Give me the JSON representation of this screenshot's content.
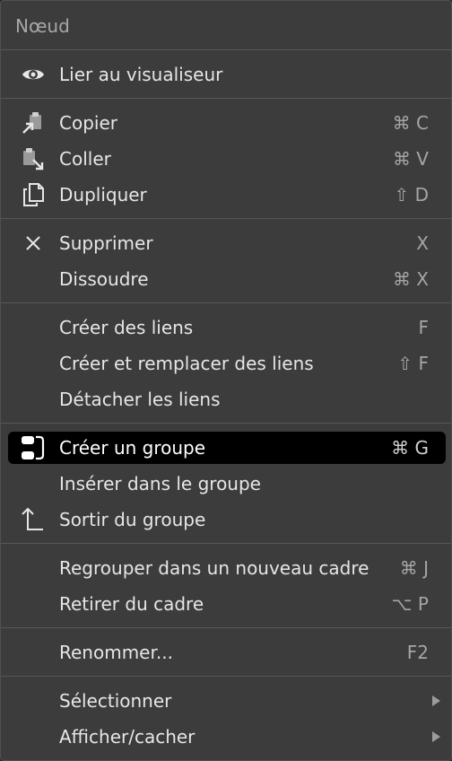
{
  "menu": {
    "title": "Nœud",
    "items": [
      {
        "label": "Lier au visualiseur",
        "shortcut": ""
      },
      {
        "label": "Copier",
        "shortcut": "⌘ C"
      },
      {
        "label": "Coller",
        "shortcut": "⌘ V"
      },
      {
        "label": "Dupliquer",
        "shortcut": "⇧ D"
      },
      {
        "label": "Supprimer",
        "shortcut": "X"
      },
      {
        "label": "Dissoudre",
        "shortcut": "⌘ X"
      },
      {
        "label": "Créer des liens",
        "shortcut": "F"
      },
      {
        "label": "Créer et remplacer des liens",
        "shortcut": "⇧ F"
      },
      {
        "label": "Détacher les liens",
        "shortcut": ""
      },
      {
        "label": "Créer un groupe",
        "shortcut": "⌘ G"
      },
      {
        "label": "Insérer dans le groupe",
        "shortcut": ""
      },
      {
        "label": "Sortir du groupe",
        "shortcut": ""
      },
      {
        "label": "Regrouper dans un nouveau cadre",
        "shortcut": "⌘ J"
      },
      {
        "label": "Retirer du cadre",
        "shortcut": "⌥ P"
      },
      {
        "label": "Renommer...",
        "shortcut": "F2"
      },
      {
        "label": "Sélectionner",
        "shortcut": ""
      },
      {
        "label": "Afficher/cacher",
        "shortcut": ""
      }
    ]
  },
  "colors": {
    "menu_background": "#3c3c3c",
    "highlight_background": "#000000",
    "text": "#e6e6e6",
    "shortcut_text": "#a5a5a5"
  },
  "icons": [
    "eye-icon",
    "copy-icon",
    "paste-icon",
    "duplicate-icon",
    "delete-x-icon",
    "make-group-icon",
    "ungroup-arrow-icon"
  ]
}
